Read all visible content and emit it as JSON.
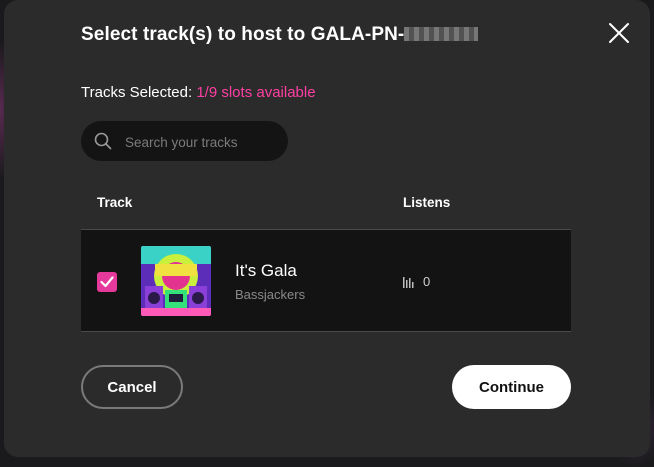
{
  "dialog": {
    "title_prefix": "Select track(s) to host to GALA-PN-",
    "title_masked_icon": "redacted-pixel-block",
    "close_icon": "close-icon"
  },
  "selection": {
    "label": "Tracks Selected: ",
    "slots": "1/9 slots available",
    "slots_color": "#ff3fa4"
  },
  "search": {
    "placeholder": "Search your tracks",
    "value": "",
    "icon": "search-icon"
  },
  "table": {
    "headers": {
      "track": "Track",
      "listens": "Listens"
    },
    "rows": [
      {
        "checked": true,
        "title": "It's Gala",
        "artist": "Bassjackers",
        "listens": "0",
        "listens_icon": "bar-chart-icon"
      }
    ]
  },
  "actions": {
    "cancel": "Cancel",
    "continue": "Continue"
  },
  "colors": {
    "accent": "#e5399b",
    "dialog_bg": "#2b2b2b",
    "row_bg": "#131313"
  }
}
